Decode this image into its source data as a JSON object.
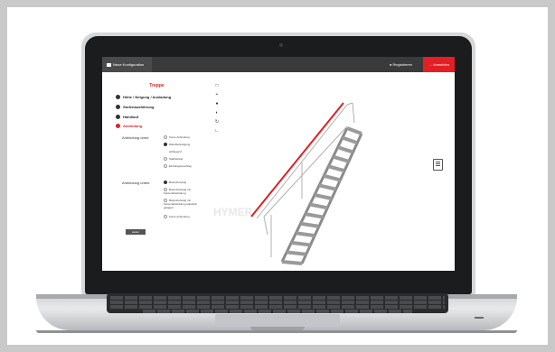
{
  "topbar": {
    "project_label": "Neue Konfiguration",
    "register_label": "Registrieren",
    "login_label": "Anmelden"
  },
  "panel": {
    "title": "Treppe",
    "steps": [
      {
        "label": "Höhe / Neigung / Ausladung",
        "active": false
      },
      {
        "label": "Stufenausführung",
        "active": false
      },
      {
        "label": "Handlauf",
        "active": false
      },
      {
        "label": "Anbindung",
        "active": true
      }
    ],
    "top_group": {
      "label": "Anbindung oben:",
      "options": [
        "Keine Anbindung",
        "Wandbefestigung",
        "aufliegend",
        "Stahlwinkel",
        "Einhängebeschlag"
      ],
      "selected": 1
    },
    "bottom_group": {
      "label": "Anbindung unten:",
      "options": [
        "Bodenbefestig",
        "Bodenbefestig mit Kantenabwinklung",
        "Bodenbefestig mit Kantenabwinklung elastisch gelagert",
        "Keine Anbindung"
      ],
      "selected": 0
    },
    "next_label": "weiter"
  },
  "viewer": {
    "watermark": "HYMER",
    "tools": [
      "fullscreen-icon",
      "move-icon",
      "view-icon",
      "contrast-icon",
      "rotate-icon",
      "measure-icon"
    ],
    "colors": {
      "accent": "#e31e24",
      "rail": "#e31e24",
      "stair": "#9a9a9a"
    }
  }
}
